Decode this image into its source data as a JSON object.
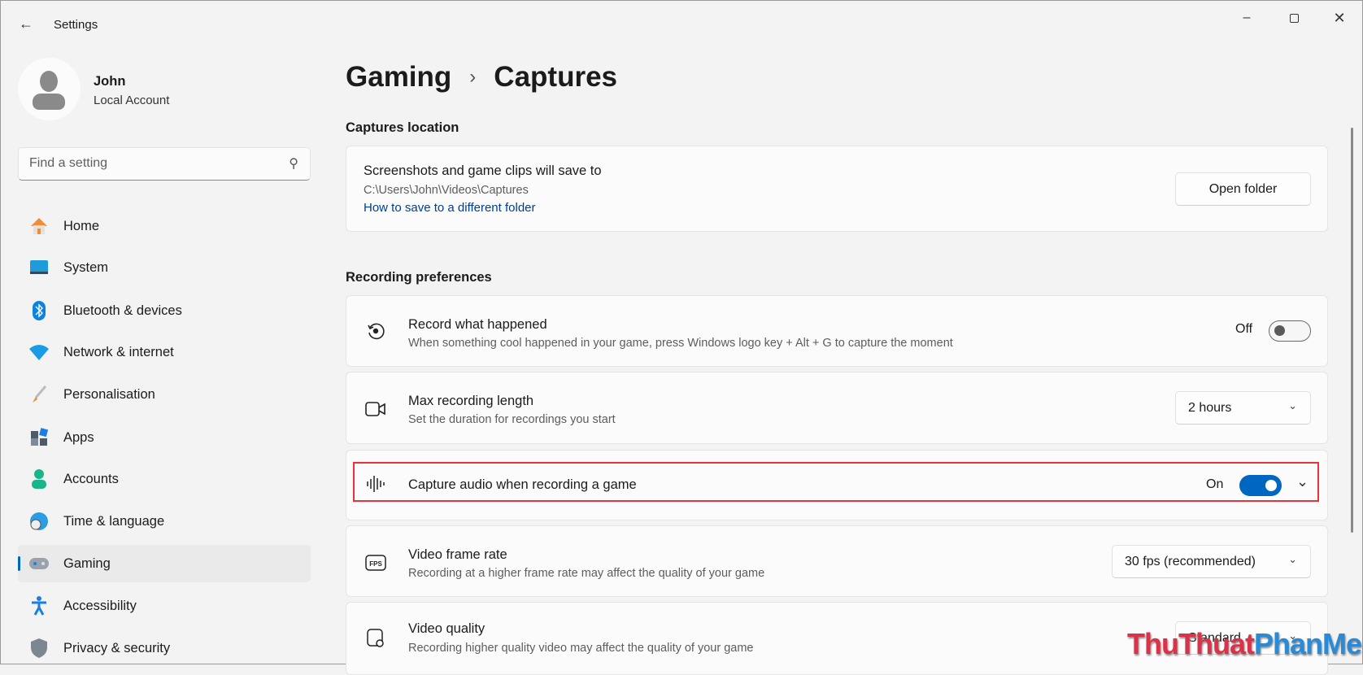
{
  "window": {
    "title": "Settings",
    "controls": [
      "minimize",
      "maximize",
      "close"
    ]
  },
  "user": {
    "name": "John",
    "account_type": "Local Account"
  },
  "search": {
    "placeholder": "Find a setting"
  },
  "nav": [
    {
      "label": "Home",
      "icon": "home-icon"
    },
    {
      "label": "System",
      "icon": "system-icon"
    },
    {
      "label": "Bluetooth & devices",
      "icon": "bluetooth-icon"
    },
    {
      "label": "Network & internet",
      "icon": "wifi-icon"
    },
    {
      "label": "Personalisation",
      "icon": "brush-icon"
    },
    {
      "label": "Apps",
      "icon": "apps-icon"
    },
    {
      "label": "Accounts",
      "icon": "accounts-icon"
    },
    {
      "label": "Time & language",
      "icon": "globe-clock-icon"
    },
    {
      "label": "Gaming",
      "icon": "gamepad-icon",
      "active": true
    },
    {
      "label": "Accessibility",
      "icon": "accessibility-icon"
    },
    {
      "label": "Privacy & security",
      "icon": "shield-icon"
    }
  ],
  "breadcrumb": {
    "parent": "Gaming",
    "current": "Captures"
  },
  "captures_location": {
    "heading": "Captures location",
    "title": "Screenshots and game clips will save to",
    "path": "C:\\Users\\John\\Videos\\Captures",
    "link": "How to save to a different folder",
    "button": "Open folder"
  },
  "recording": {
    "heading": "Recording preferences",
    "record_what_happened": {
      "title": "Record what happened",
      "subtitle": "When something cool happened in your game, press Windows logo key + Alt + G to capture the moment",
      "state": "Off"
    },
    "max_length": {
      "title": "Max recording length",
      "subtitle": "Set the duration for recordings you start",
      "value": "2 hours"
    },
    "capture_audio": {
      "title": "Capture audio when recording a game",
      "state": "On"
    },
    "frame_rate": {
      "title": "Video frame rate",
      "subtitle": "Recording at a higher frame rate may affect the quality of your game",
      "value": "30 fps (recommended)"
    },
    "quality": {
      "title": "Video quality",
      "subtitle": "Recording higher quality video may affect the quality of your game",
      "value": "Standard"
    }
  },
  "colors": {
    "accent": "#0067c0",
    "highlight": "#e8333a"
  },
  "watermark": {
    "part1": "ThuThuat",
    "part2": "PhanMem.vn"
  }
}
